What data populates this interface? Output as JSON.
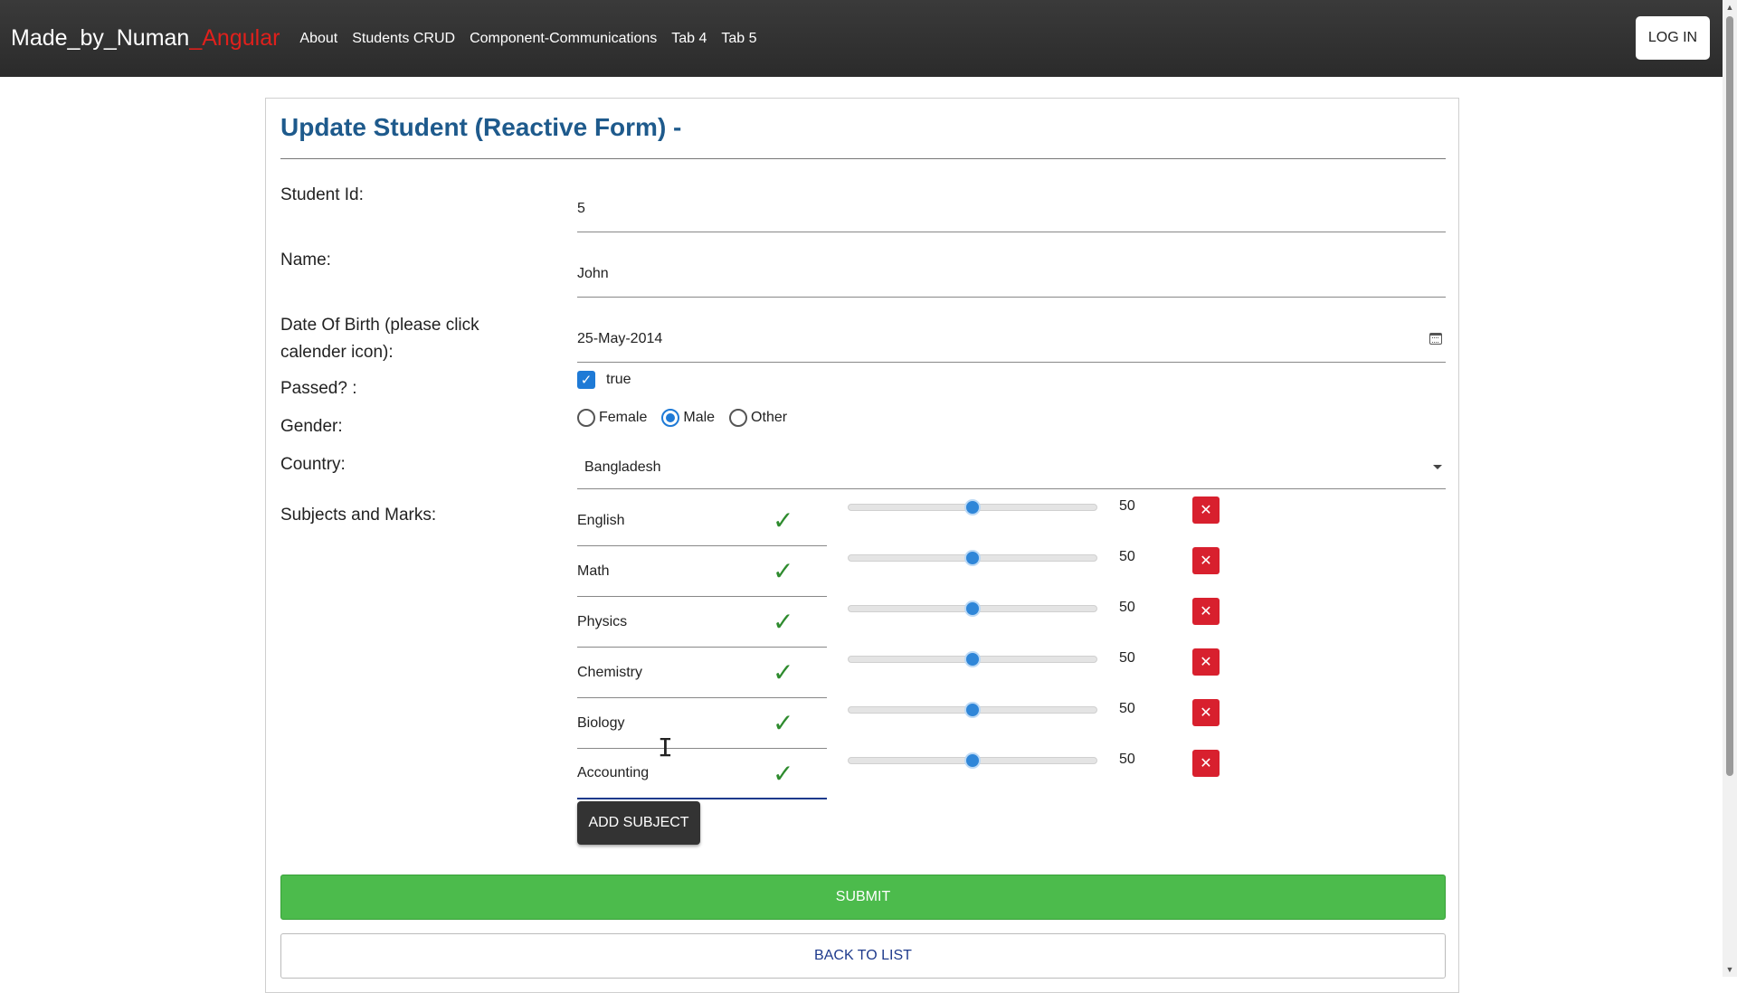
{
  "navbar": {
    "brand_main": "Made_by_Numan",
    "brand_accent": "_Angular",
    "links": [
      "About",
      "Students CRUD",
      "Component-Communications",
      "Tab 4",
      "Tab 5"
    ],
    "login_label": "LOG IN"
  },
  "form": {
    "title": "Update Student (Reactive Form) -",
    "student_id_label": "Student Id:",
    "student_id_value": "5",
    "name_label": "Name:",
    "name_value": "John",
    "dob_label": "Date Of Birth (please click calender icon):",
    "dob_value": "25-May-2014",
    "passed_label": "Passed? :",
    "passed_value": "true",
    "gender_label": "Gender:",
    "gender_options": [
      "Female",
      "Male",
      "Other"
    ],
    "gender_selected": "Male",
    "country_label": "Country:",
    "country_value": "Bangladesh",
    "subjects_label": "Subjects and Marks:",
    "subjects": [
      {
        "name": "English",
        "mark": "50"
      },
      {
        "name": "Math",
        "mark": "50"
      },
      {
        "name": "Physics",
        "mark": "50"
      },
      {
        "name": "Chemistry",
        "mark": "50"
      },
      {
        "name": "Biology",
        "mark": "50"
      },
      {
        "name": "Accounting",
        "mark": "50"
      }
    ],
    "slider_fraction": 0.5,
    "add_subject_label": "ADD SUBJECT",
    "submit_label": "SUBMIT",
    "back_label": "BACK TO LIST"
  },
  "colors": {
    "navbar": "#2b2b2b",
    "brand_accent": "#e0201c",
    "title": "#1e5a8c",
    "submit": "#4cbb4c",
    "remove": "#d8202e",
    "primary": "#1e7ad6"
  }
}
